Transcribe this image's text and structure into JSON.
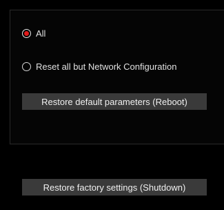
{
  "reset_options": [
    {
      "label": "All",
      "selected": true
    },
    {
      "label": "Reset all but Network Configuration",
      "selected": false
    }
  ],
  "buttons": {
    "restore_default": "Restore default parameters (Reboot)",
    "restore_factory": "Restore factory settings (Shutdown)"
  },
  "colors": {
    "accent": "#e11a1a",
    "button_bg": "#3a3a3a",
    "background": "#000000"
  }
}
